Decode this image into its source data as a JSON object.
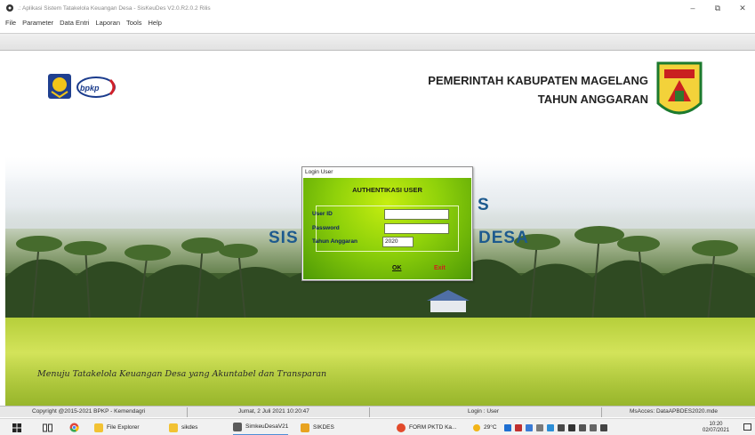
{
  "window": {
    "title": ".: Aplikasi Sistem Tatakelola Keuangan Desa - SisKeuDes V2.0.R2.0.2 Rilis",
    "controls": [
      "–",
      "⧉",
      "✕"
    ]
  },
  "menu": [
    "File",
    "Parameter",
    "Data Entri",
    "Laporan",
    "Tools",
    "Help"
  ],
  "header": {
    "gov_title": "PEMERINTAH KABUPATEN MAGELANG",
    "gov_year": "TAHUN ANGGARAN",
    "bpkp_logo_text": "bpkp"
  },
  "background": {
    "app_title_left": "SIS",
    "app_title_right": "DESA",
    "app_title_s": "S",
    "motto": "Menuju Tatakelola Keuangan Desa yang Akuntabel dan Transparan"
  },
  "login": {
    "window_title": "Login User",
    "header": "AUTHENTIKASI USER",
    "user_id_label": "User ID",
    "user_id_value": "",
    "password_label": "Password",
    "password_value": "",
    "year_label": "Tahun Anggaran",
    "year_value": "2020",
    "ok_label": "OK",
    "exit_label": "Exit"
  },
  "statusbar": {
    "copyright": "Copyright @2015-2021 BPKP - Kemendagri",
    "datetime": "Jumat, 2 Juli 2021  10:20:47",
    "login": "Login : User",
    "database": "MsAcces: DataAPBDES2020.mde"
  },
  "taskbar": {
    "items": [
      {
        "label": "File Explorer",
        "color": "#f2c233"
      },
      {
        "label": "sikdes",
        "color": "#f2c233"
      },
      {
        "label": "SimkeuDesaV21",
        "color": "#5a5a5a"
      },
      {
        "label": "SIKDES",
        "color": "#e8a320"
      },
      {
        "label": "FORM PKTD Ka...",
        "color": "#e24a2b"
      }
    ],
    "weather": "29°C",
    "clock_time": "10:20",
    "clock_date": "02/07/2021"
  },
  "colors": {
    "login_green_light": "#c6ee10",
    "login_green_dark": "#4e9a06",
    "app_title_blue": "#1d5a8e",
    "exit_red": "#d21e1e"
  }
}
